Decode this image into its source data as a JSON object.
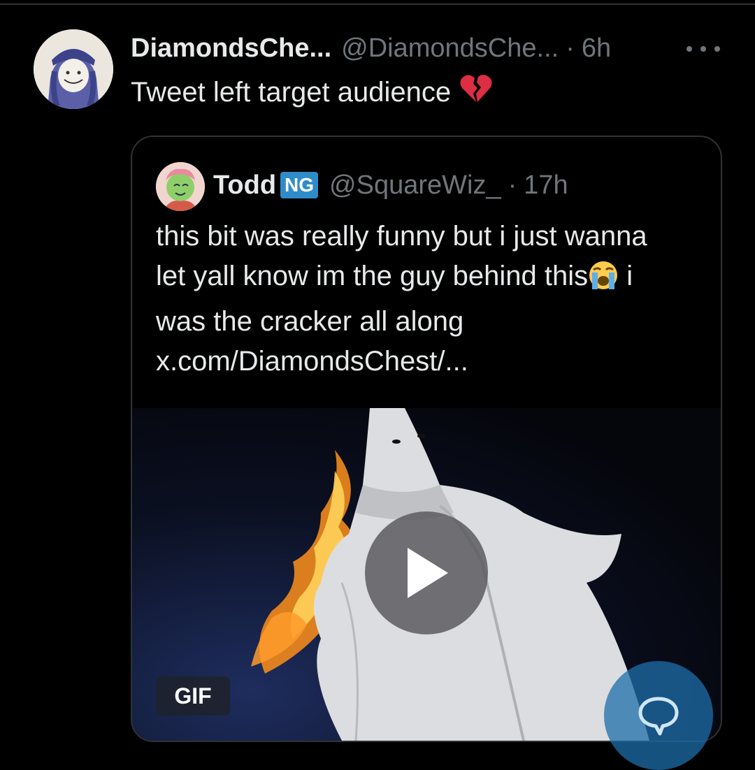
{
  "tweet": {
    "display_name": "DiamondsChe...",
    "handle": "@DiamondsChe...",
    "separator": "·",
    "time": "6h",
    "text": "Tweet left target audience",
    "emoji": "broken-heart"
  },
  "quoted_tweet": {
    "display_name": "Todd",
    "badge": "NG",
    "handle": "@SquareWiz_",
    "separator": "·",
    "time": "17h",
    "text_line1": "this bit was really funny but i just wanna",
    "text_line2_a": "let yall know im the guy behind this",
    "text_line2_b": " i",
    "text_line3": "was the cracker all along",
    "link": "x.com/DiamondsChest/...",
    "emoji": "loudly-crying-face",
    "media": {
      "type_badge": "GIF",
      "play_icon": "play-icon"
    }
  },
  "fab": {
    "icon": "reply-bubble-icon"
  },
  "colors": {
    "background": "#000000",
    "primary_text": "#e7e9ea",
    "secondary_text": "#71767b",
    "border": "#2f3336",
    "accent": "#1d9bf0"
  }
}
